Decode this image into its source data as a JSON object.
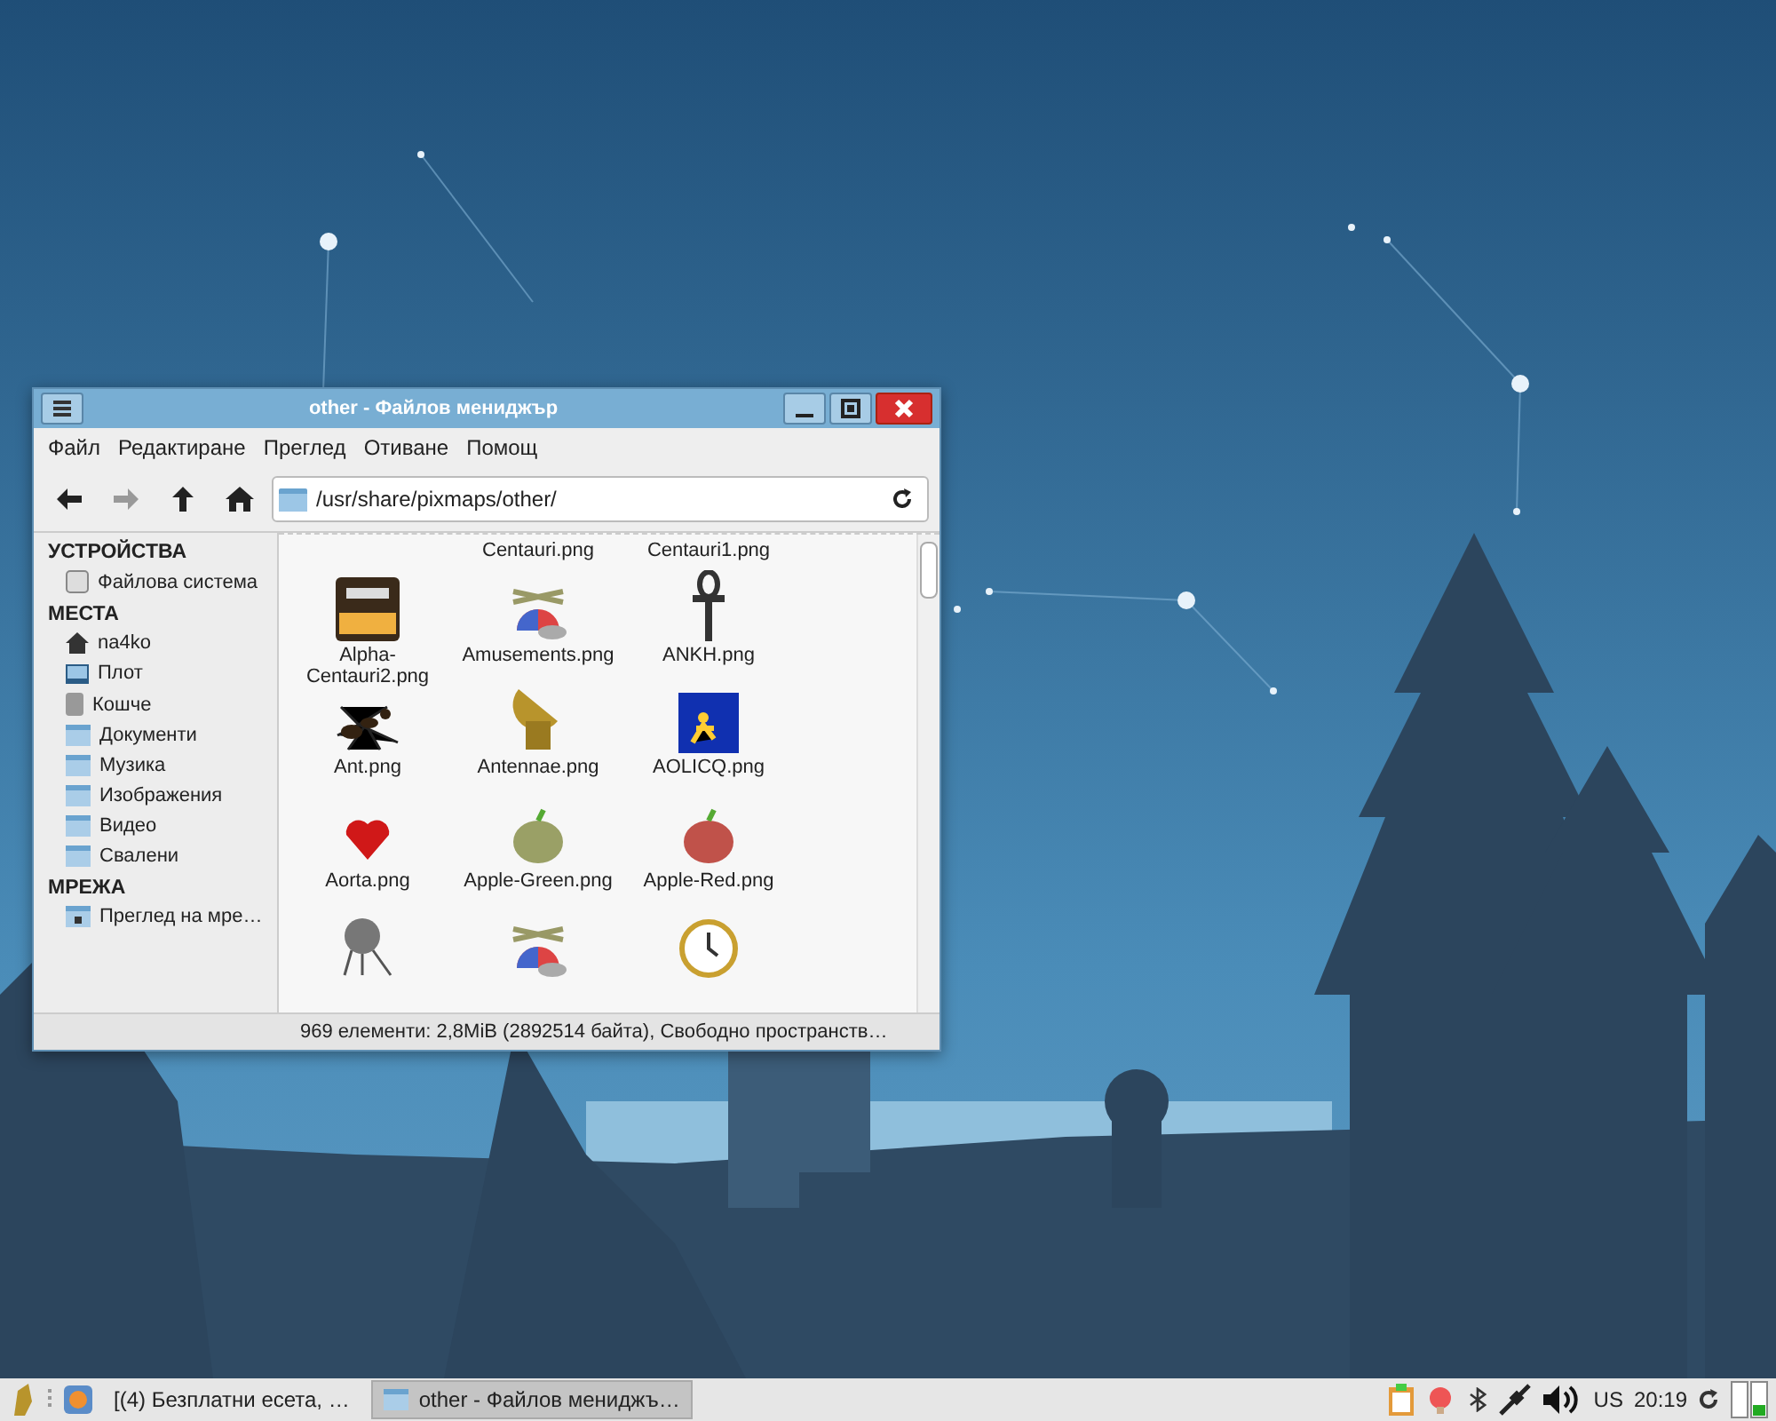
{
  "window": {
    "title": "other - Файлов мениджър",
    "menu": [
      "Файл",
      "Редактиране",
      "Преглед",
      "Отиване",
      "Помощ"
    ],
    "path": "/usr/share/pixmaps/other/",
    "sidebar": [
      {
        "heading": "УСТРОЙСТВА",
        "items": [
          {
            "label": "Файлова система",
            "kind": "disk"
          }
        ]
      },
      {
        "heading": "МЕСТА",
        "items": [
          {
            "label": "na4ko",
            "kind": "home"
          },
          {
            "label": "Плот",
            "kind": "desktop"
          },
          {
            "label": "Кошче",
            "kind": "trash"
          },
          {
            "label": "Документи",
            "kind": "folder"
          },
          {
            "label": "Музика",
            "kind": "folder"
          },
          {
            "label": "Изображения",
            "kind": "folder"
          },
          {
            "label": "Видео",
            "kind": "folder"
          },
          {
            "label": "Свалени",
            "kind": "folder"
          }
        ]
      },
      {
        "heading": "МРЕЖА",
        "items": [
          {
            "label": "Преглед на мре…",
            "kind": "network"
          }
        ]
      }
    ],
    "cut_labels": [
      "Centauri.png",
      "Centauri1.png"
    ],
    "files": [
      {
        "label": "Alpha-Centauri2.png",
        "kind": "poster"
      },
      {
        "label": "Amusements.png",
        "kind": "cap"
      },
      {
        "label": "ANKH.png",
        "kind": "ankh"
      },
      {
        "label": "Ant.png",
        "kind": "ant"
      },
      {
        "label": "Antennae.png",
        "kind": "dish"
      },
      {
        "label": "AOLICQ.png",
        "kind": "icq"
      },
      {
        "label": "Aorta.png",
        "kind": "heart"
      },
      {
        "label": "Apple-Green.png",
        "kind": "apple",
        "color": "#9aa066"
      },
      {
        "label": "Apple-Red.png",
        "kind": "apple",
        "color": "#c0524a"
      },
      {
        "kind": "sphere"
      },
      {
        "kind": "cap"
      },
      {
        "kind": "clock"
      }
    ],
    "status": "969 елементи: 2,8MiB (2892514 байта), Свободно пространств…"
  },
  "taskbar": {
    "tasks": [
      {
        "label": "[(4) Безплатни есета, …",
        "selected": false
      },
      {
        "label": "other - Файлов мениджъ…",
        "selected": true
      }
    ],
    "keyboard": "US",
    "clock": "20:19"
  }
}
